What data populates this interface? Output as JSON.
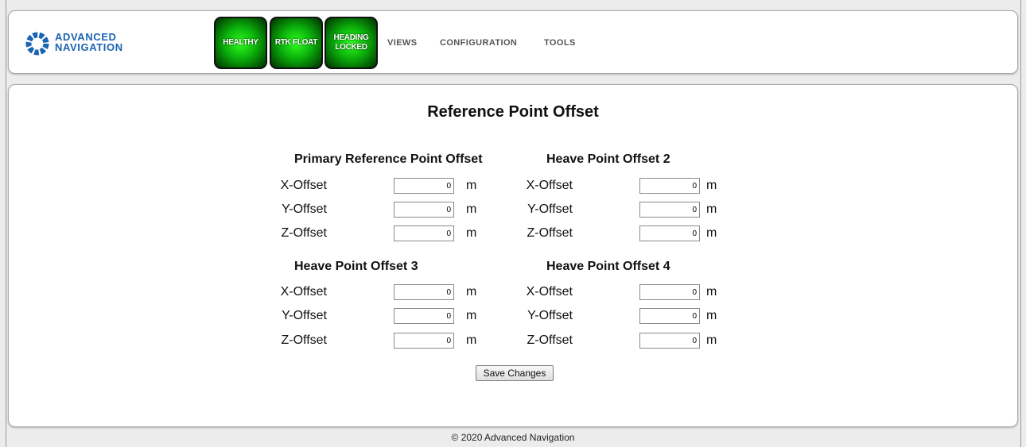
{
  "brand": {
    "line1": "ADVANCED",
    "line2": "NAVIGATION",
    "logo_icon": "ring-logo-icon",
    "color": "#1b63b3"
  },
  "status_indicators": [
    {
      "line1": "HEALTHY",
      "line2": "",
      "color": "#14c814"
    },
    {
      "line1": "RTK FLOAT",
      "line2": "",
      "color": "#14c814"
    },
    {
      "line1": "HEADING",
      "line2": "LOCKED",
      "color": "#14c814"
    }
  ],
  "nav": {
    "views": "VIEWS",
    "configuration": "CONFIGURATION",
    "tools": "TOOLS"
  },
  "page_title": "Reference Point Offset",
  "sections": [
    {
      "title": "Primary Reference Point Offset",
      "fields": [
        {
          "label": "X-Offset",
          "value": "0",
          "unit": "m"
        },
        {
          "label": "Y-Offset",
          "value": "0",
          "unit": "m"
        },
        {
          "label": "Z-Offset",
          "value": "0",
          "unit": "m"
        }
      ]
    },
    {
      "title": "Heave Point Offset 2",
      "fields": [
        {
          "label": "X-Offset",
          "value": "0",
          "unit": "m"
        },
        {
          "label": "Y-Offset",
          "value": "0",
          "unit": "m"
        },
        {
          "label": "Z-Offset",
          "value": "0",
          "unit": "m"
        }
      ]
    },
    {
      "title": "Heave Point Offset 3",
      "fields": [
        {
          "label": "X-Offset",
          "value": "0",
          "unit": "m"
        },
        {
          "label": "Y-Offset",
          "value": "0",
          "unit": "m"
        },
        {
          "label": "Z-Offset",
          "value": "0",
          "unit": "m"
        }
      ]
    },
    {
      "title": "Heave Point Offset 4",
      "fields": [
        {
          "label": "X-Offset",
          "value": "0",
          "unit": "m"
        },
        {
          "label": "Y-Offset",
          "value": "0",
          "unit": "m"
        },
        {
          "label": "Z-Offset",
          "value": "0",
          "unit": "m"
        }
      ]
    }
  ],
  "save_button": "Save Changes",
  "footer": "© 2020 Advanced Navigation"
}
